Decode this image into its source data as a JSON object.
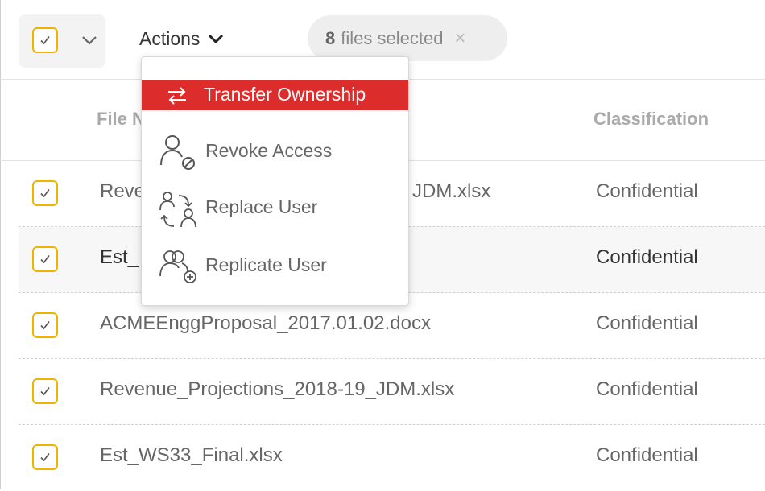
{
  "toolbar": {
    "actions_label": "Actions",
    "selection": {
      "count": "8",
      "text": "files selected",
      "close_glyph": "×"
    }
  },
  "table": {
    "headers": {
      "file_name": "File N",
      "classification": "Classification"
    },
    "rows": [
      {
        "file_name": "Reve",
        "file_name_tail": "JDM.xlsx",
        "classification": "Confidential"
      },
      {
        "file_name": "Est_",
        "classification": "Confidential"
      },
      {
        "file_name": "ACMEEnggProposal_2017.01.02.docx",
        "classification": "Confidential"
      },
      {
        "file_name": "Revenue_Projections_2018-19_JDM.xlsx",
        "classification": "Confidential"
      },
      {
        "file_name": "Est_WS33_Final.xlsx",
        "classification": "Confidential"
      }
    ]
  },
  "actions_menu": {
    "items": [
      {
        "label": "Transfer Ownership",
        "icon": "transfer-icon",
        "active": true
      },
      {
        "label": "Revoke Access",
        "icon": "user-revoke-icon"
      },
      {
        "label": "Replace User",
        "icon": "user-replace-icon"
      },
      {
        "label": "Replicate User",
        "icon": "user-replicate-icon"
      }
    ]
  },
  "colors": {
    "accent": "#f0b400",
    "menu_active": "#dd2c2c"
  }
}
